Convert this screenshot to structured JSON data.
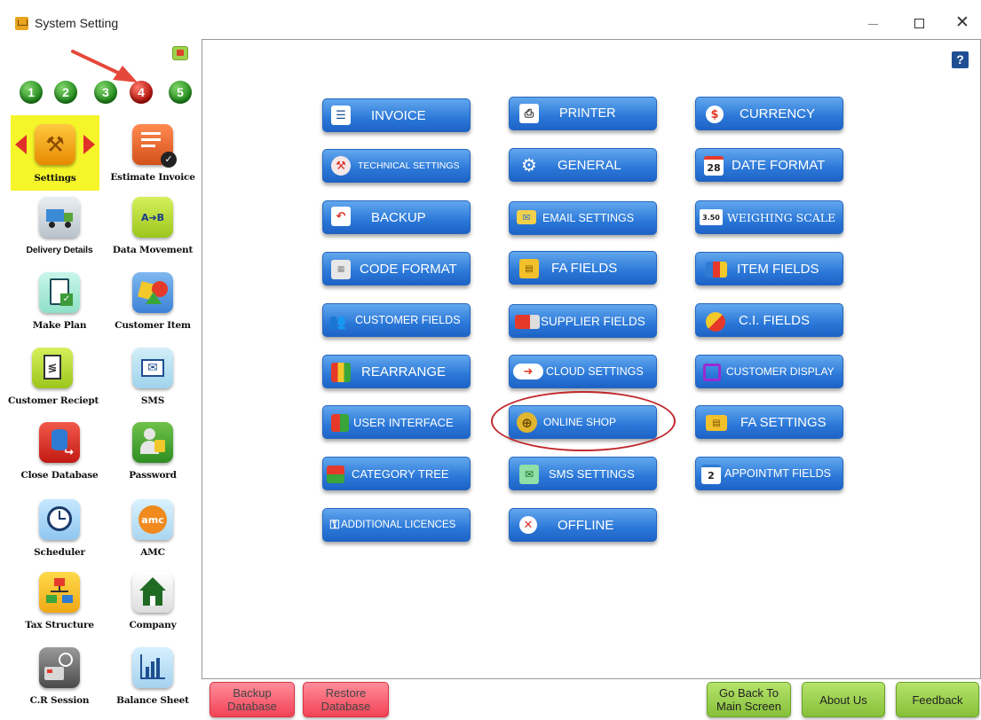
{
  "window": {
    "title": "System Setting"
  },
  "sidebar": {
    "page_numbers": [
      "1",
      "2",
      "3",
      "4",
      "5"
    ],
    "selected_page": "4",
    "tiles": [
      {
        "label": "Settings",
        "icon": "wrench-icon"
      },
      {
        "label": "Estimate Invoice",
        "icon": "estimate-invoice-icon"
      },
      {
        "label": "Delivery Details",
        "icon": "delivery-truck-icon"
      },
      {
        "label": "Data Movement",
        "icon": "data-movement-icon"
      },
      {
        "label": "Make Plan",
        "icon": "clipboard-check-icon"
      },
      {
        "label": "Customer Item",
        "icon": "shapes-icon"
      },
      {
        "label": "Customer Reciept",
        "icon": "receipt-icon"
      },
      {
        "label": "SMS",
        "icon": "sms-envelope-icon"
      },
      {
        "label": "Close Database",
        "icon": "database-close-icon"
      },
      {
        "label": "Password",
        "icon": "password-user-icon"
      },
      {
        "label": "Scheduler",
        "icon": "alarm-clock-icon"
      },
      {
        "label": "AMC",
        "icon": "amc-icon"
      },
      {
        "label": "Tax Structure",
        "icon": "tax-structure-icon"
      },
      {
        "label": "Company",
        "icon": "company-house-icon"
      },
      {
        "label": "C.R Session",
        "icon": "cash-register-icon"
      },
      {
        "label": "Balance Sheet",
        "icon": "balance-sheet-icon"
      }
    ],
    "amc_icon_text": "amc"
  },
  "settings_buttons": {
    "col1": [
      {
        "label": "INVOICE",
        "icon": "invoice-icon"
      },
      {
        "label": "TECHNICAL SETTINGS",
        "icon": "technical-settings-icon"
      },
      {
        "label": "BACKUP",
        "icon": "backup-arrow-icon"
      },
      {
        "label": "CODE FORMAT",
        "icon": "code-format-icon"
      },
      {
        "label": "CUSTOMER FIELDS",
        "icon": "customer-fields-icon"
      },
      {
        "label": "REARRANGE",
        "icon": "rearrange-icon"
      },
      {
        "label": "USER INTERFACE",
        "icon": "user-interface-icon"
      },
      {
        "label": "CATEGORY TREE",
        "icon": "category-tree-icon"
      },
      {
        "label": "ADDITIONAL LICENCES",
        "icon": "key-icon"
      }
    ],
    "col2": [
      {
        "label": "PRINTER",
        "icon": "printer-icon"
      },
      {
        "label": "GENERAL",
        "icon": "gear-icon"
      },
      {
        "label": "EMAIL SETTINGS",
        "icon": "email-icon"
      },
      {
        "label": "FA FIELDS",
        "icon": "fa-fields-icon"
      },
      {
        "label": "SUPPLIER FIELDS",
        "icon": "supplier-truck-icon"
      },
      {
        "label": "CLOUD SETTINGS",
        "icon": "cloud-icon"
      },
      {
        "label": "ONLINE SHOP",
        "icon": "globe-icon"
      },
      {
        "label": "SMS SETTINGS",
        "icon": "sms-settings-icon"
      },
      {
        "label": "OFFLINE",
        "icon": "offline-x-icon"
      }
    ],
    "col3": [
      {
        "label": "CURRENCY",
        "icon": "currency-dollar-icon"
      },
      {
        "label": "DATE FORMAT",
        "icon": "calendar-icon",
        "icon_text": "28"
      },
      {
        "label": "WEIGHING SCALE",
        "icon": "weighing-scale-icon",
        "icon_text": "3.50"
      },
      {
        "label": "ITEM FIELDS",
        "icon": "item-fields-icon"
      },
      {
        "label": "C.I. FIELDS",
        "icon": "ci-fields-icon"
      },
      {
        "label": "CUSTOMER DISPLAY",
        "icon": "customer-display-icon"
      },
      {
        "label": "FA SETTINGS",
        "icon": "fa-settings-icon"
      },
      {
        "label": "APPOINTMT FIELDS",
        "icon": "appointment-calendar-icon",
        "icon_text": "2"
      }
    ]
  },
  "bottom": {
    "backup_line1": "Backup",
    "backup_line2": "Database",
    "restore_line1": "Restore",
    "restore_line2": "Database",
    "goback_line1": "Go Back To",
    "goback_line2": "Main Screen",
    "about": "About Us",
    "feedback": "Feedback"
  },
  "help_label": "?",
  "colors": {
    "button_blue": "#2b78d8",
    "selected_yellow": "#f5f52a",
    "annotation_red": "#c0282d"
  }
}
